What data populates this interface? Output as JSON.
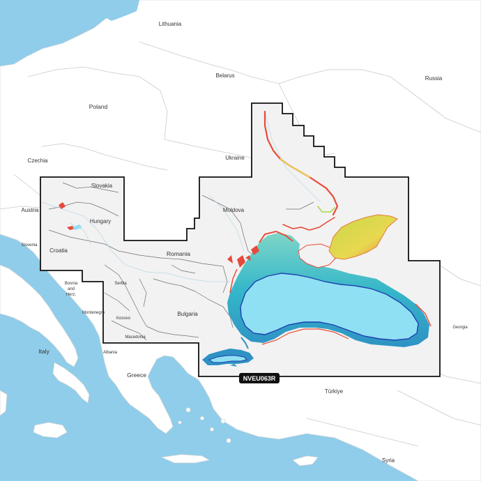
{
  "map": {
    "chart_id": "NVEU063R",
    "countries": {
      "lithuania": "Lithuania",
      "belarus": "Belarus",
      "russia": "Russia",
      "poland": "Poland",
      "czechia": "Czechia",
      "ukraine": "Ukraine",
      "slovakia": "Slovakia",
      "austria": "Austria",
      "hungary": "Hungary",
      "moldova": "Moldova",
      "slovenia": "Slovenia",
      "croatia": "Croatia",
      "romania": "Romania",
      "bosnia_1": "Bosnia",
      "bosnia_2": "and",
      "bosnia_3": "Herz.",
      "serbia": "Serbia",
      "montenegro": "Montenegro",
      "kosovo": "Kosovo",
      "bulgaria": "Bulgaria",
      "macedonia": "Macedonia",
      "albania": "Albania",
      "italy": "Italy",
      "greece": "Greece",
      "georgia": "Georgia",
      "turkiye": "Türkiye",
      "syria": "Syria"
    },
    "colors": {
      "sea": "#8fcdea",
      "land": "#ffffff",
      "coverage_fill": "#f2f2f2",
      "coverage_border": "#111111",
      "deep_water": "#8fe0f3",
      "shallow_water": "#e8e04a",
      "coastal_depth": "#e84a3a",
      "depth_contour": "#1e3fb0"
    }
  }
}
